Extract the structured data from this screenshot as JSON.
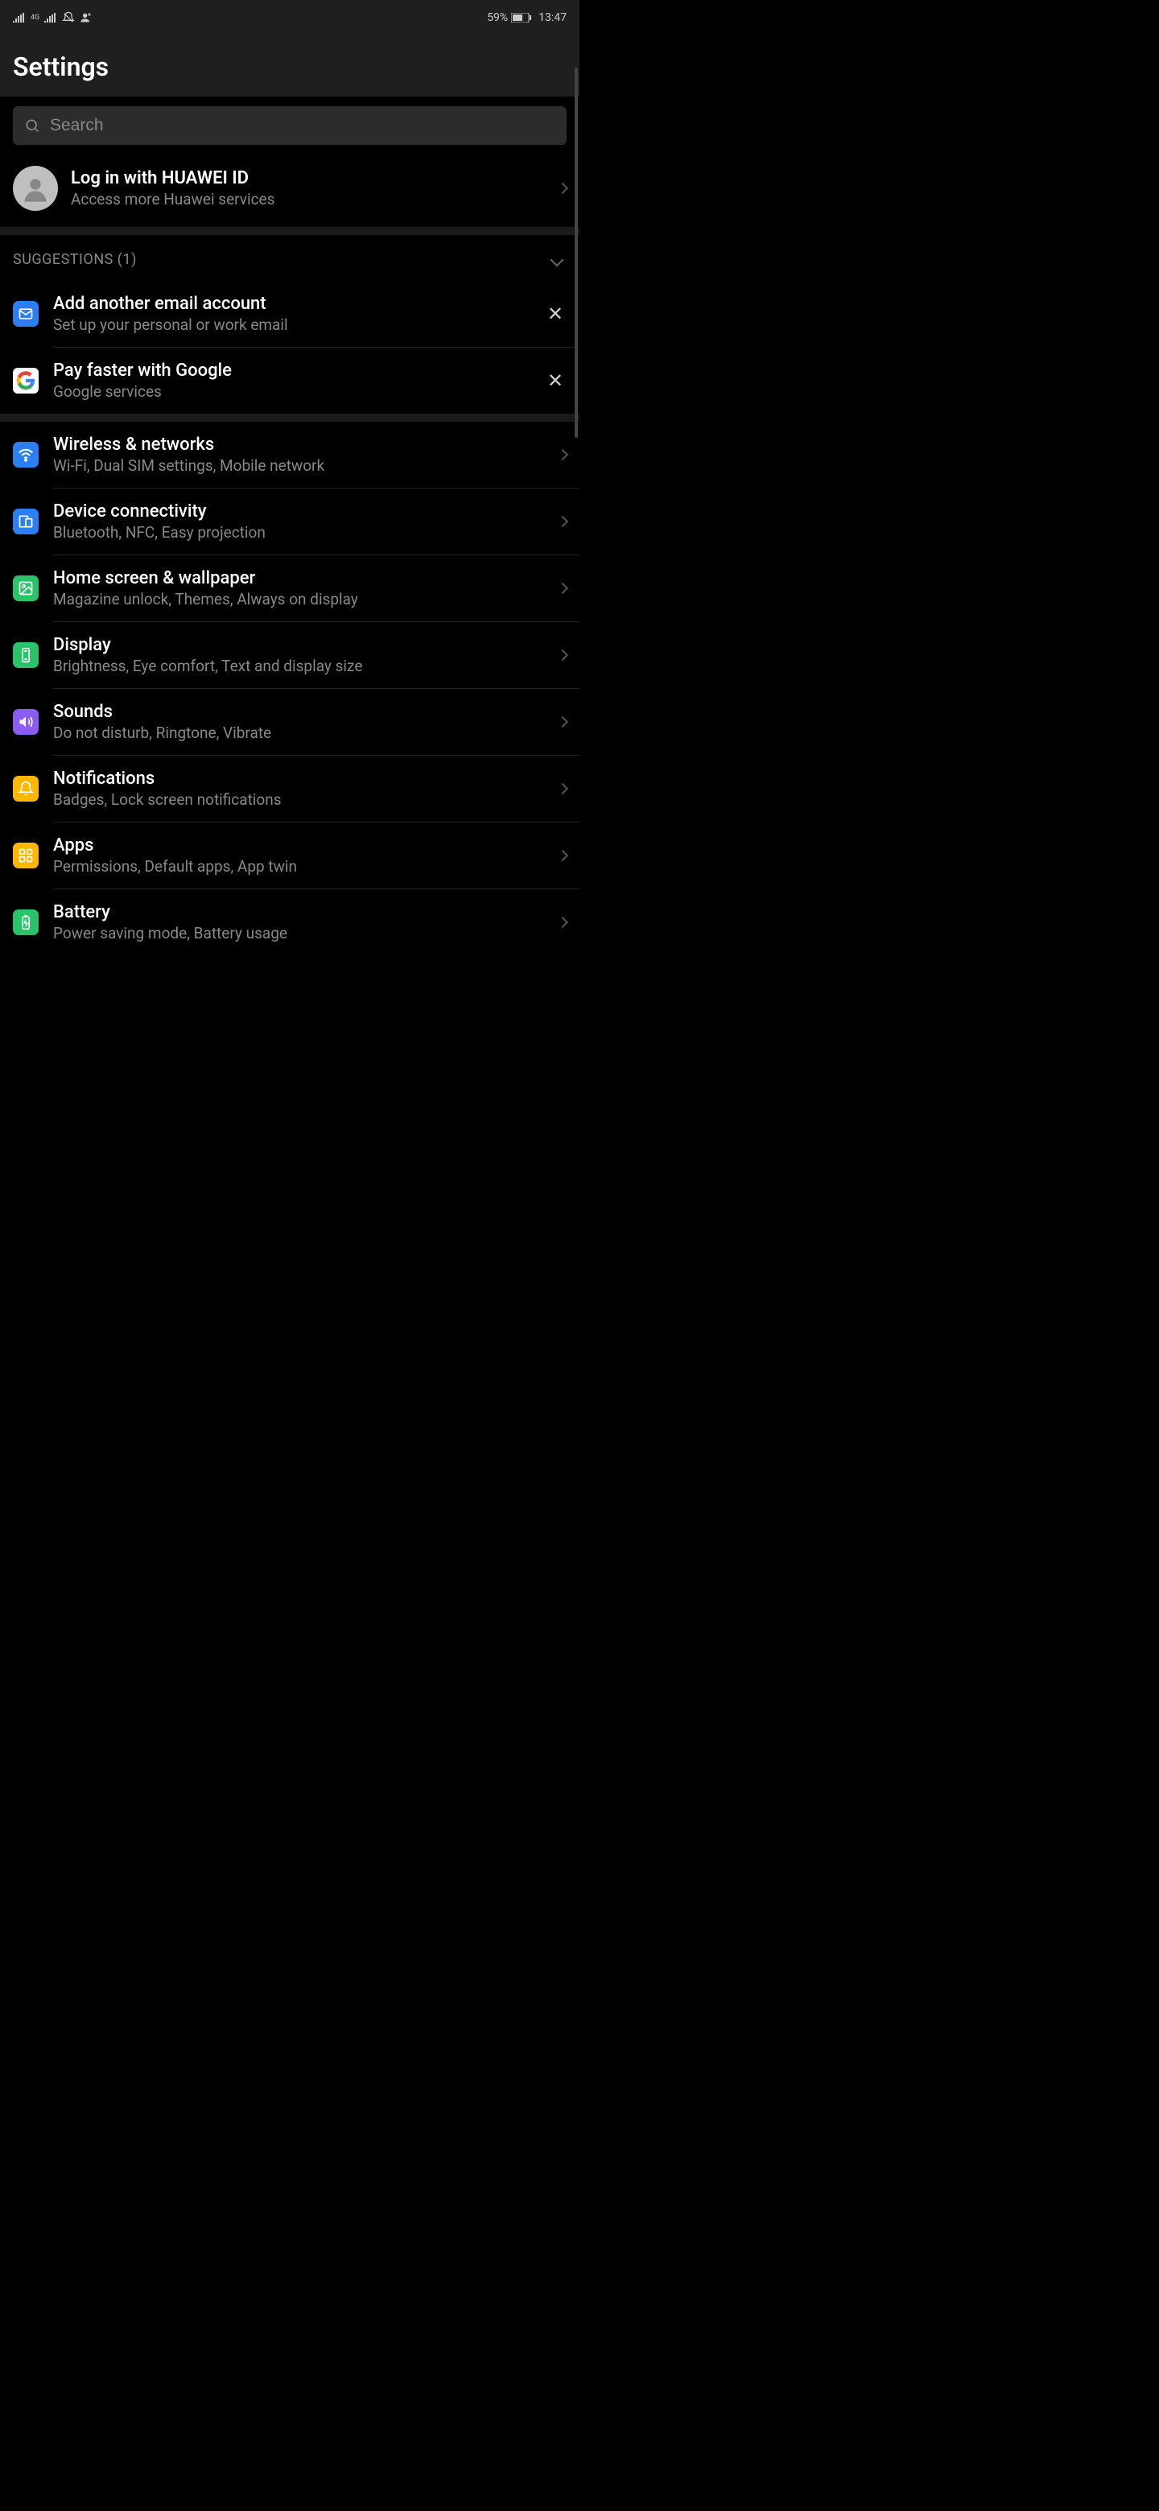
{
  "status": {
    "battery": "59%",
    "time": "13:47"
  },
  "header": {
    "title": "Settings"
  },
  "search": {
    "placeholder": "Search"
  },
  "login": {
    "title": "Log in with HUAWEI ID",
    "subtitle": "Access more Huawei services"
  },
  "suggestions": {
    "header": "SUGGESTIONS (1)",
    "items": [
      {
        "title": "Add another email account",
        "subtitle": "Set up your personal or work email",
        "icon": "mail",
        "color": "blue"
      },
      {
        "title": "Pay faster with Google",
        "subtitle": "Google services",
        "icon": "google",
        "color": "google"
      }
    ]
  },
  "settings": [
    {
      "title": "Wireless & networks",
      "subtitle": "Wi-Fi, Dual SIM settings, Mobile network",
      "icon": "wifi",
      "color": "blue"
    },
    {
      "title": "Device connectivity",
      "subtitle": "Bluetooth, NFC, Easy projection",
      "icon": "devices",
      "color": "blue"
    },
    {
      "title": "Home screen & wallpaper",
      "subtitle": "Magazine unlock, Themes, Always on display",
      "icon": "image",
      "color": "green"
    },
    {
      "title": "Display",
      "subtitle": "Brightness, Eye comfort, Text and display size",
      "icon": "phone",
      "color": "green"
    },
    {
      "title": "Sounds",
      "subtitle": "Do not disturb, Ringtone, Vibrate",
      "icon": "sound",
      "color": "purple"
    },
    {
      "title": "Notifications",
      "subtitle": "Badges, Lock screen notifications",
      "icon": "bell",
      "color": "yellow"
    },
    {
      "title": "Apps",
      "subtitle": "Permissions, Default apps, App twin",
      "icon": "apps",
      "color": "yellow"
    },
    {
      "title": "Battery",
      "subtitle": "Power saving mode, Battery usage",
      "icon": "battery",
      "color": "green"
    }
  ]
}
